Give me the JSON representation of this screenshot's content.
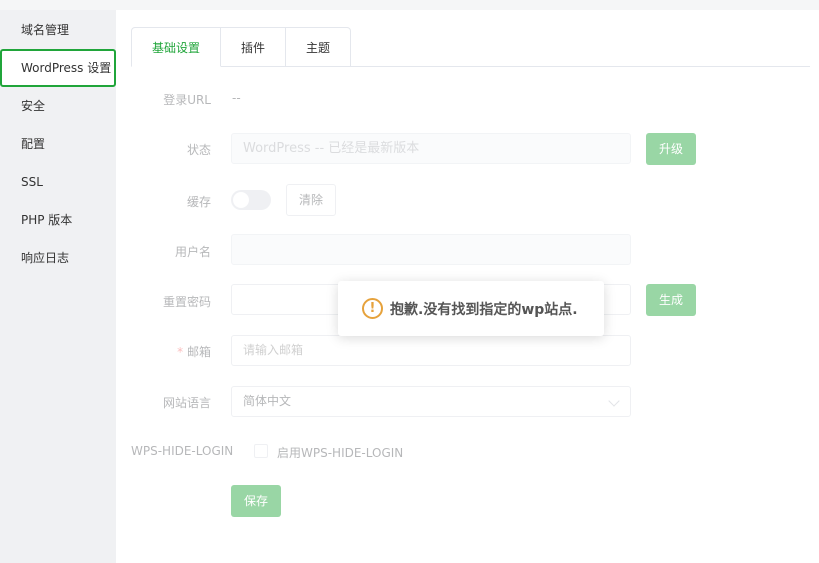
{
  "sidebar": {
    "items": [
      {
        "label": "域名管理"
      },
      {
        "label": "WordPress 设置"
      },
      {
        "label": "安全"
      },
      {
        "label": "配置"
      },
      {
        "label": "SSL"
      },
      {
        "label": "PHP 版本"
      },
      {
        "label": "响应日志"
      }
    ]
  },
  "tabs": [
    {
      "label": "基础设置"
    },
    {
      "label": "插件"
    },
    {
      "label": "主题"
    }
  ],
  "form": {
    "login_url_label": "登录URL",
    "login_url_value": "--",
    "status_label": "状态",
    "status_value": "WordPress -- 已经是最新版本",
    "upgrade_label": "升级",
    "cache_label": "缓存",
    "clear_label": "清除",
    "username_label": "用户名",
    "reset_password_label": "重置密码",
    "generate_label": "生成",
    "email_required_mark": "*",
    "email_label": "邮箱",
    "email_placeholder": "请输入邮箱",
    "language_label": "网站语言",
    "language_value": "简体中文",
    "wps_hide_login_label": "WPS-HIDE-LOGIN",
    "wps_hide_login_checkbox_label": "启用WPS-HIDE-LOGIN",
    "save_label": "保存"
  },
  "toast": {
    "icon": "warning-icon",
    "message": "抱歉.没有找到指定的wp站点."
  },
  "colors": {
    "accent": "#20a53a",
    "warning": "#e6a23c"
  }
}
